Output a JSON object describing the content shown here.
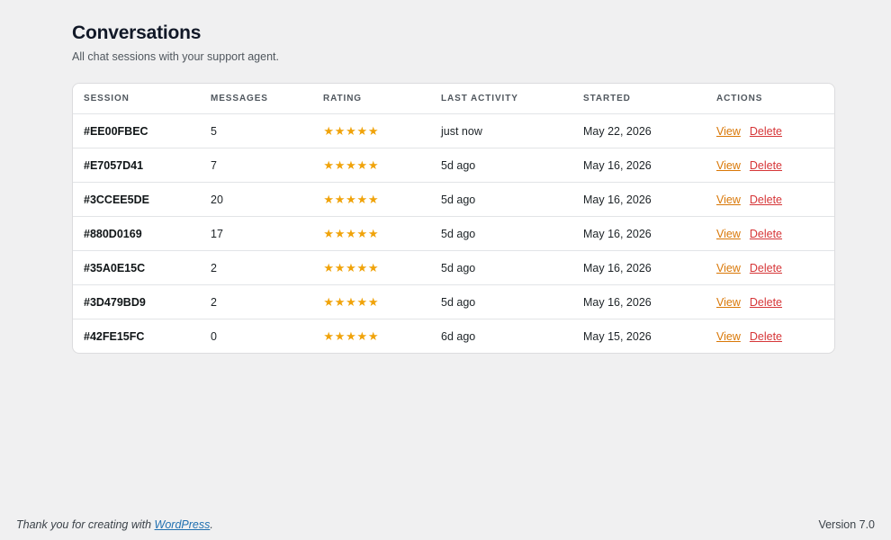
{
  "header": {
    "title": "Conversations",
    "subtitle": "All chat sessions with your support agent."
  },
  "table": {
    "columns": [
      "Session",
      "Messages",
      "Rating",
      "Last Activity",
      "Started",
      "Actions"
    ],
    "view_label": "View",
    "delete_label": "Delete",
    "rows": [
      {
        "session": "#EE00FBEC",
        "messages": "5",
        "rating": 5,
        "last_activity": "just now",
        "started": "May 22, 2026"
      },
      {
        "session": "#E7057D41",
        "messages": "7",
        "rating": 5,
        "last_activity": "5d ago",
        "started": "May 16, 2026"
      },
      {
        "session": "#3CCEE5DE",
        "messages": "20",
        "rating": 5,
        "last_activity": "5d ago",
        "started": "May 16, 2026"
      },
      {
        "session": "#880D0169",
        "messages": "17",
        "rating": 5,
        "last_activity": "5d ago",
        "started": "May 16, 2026"
      },
      {
        "session": "#35A0E15C",
        "messages": "2",
        "rating": 5,
        "last_activity": "5d ago",
        "started": "May 16, 2026"
      },
      {
        "session": "#3D479BD9",
        "messages": "2",
        "rating": 5,
        "last_activity": "5d ago",
        "started": "May 16, 2026"
      },
      {
        "session": "#42FE15FC",
        "messages": "0",
        "rating": 5,
        "last_activity": "6d ago",
        "started": "May 15, 2026"
      }
    ]
  },
  "footer": {
    "thanks_prefix": "Thank you for creating with ",
    "wordpress_link": "WordPress",
    "thanks_suffix": ".",
    "version": "Version 7.0"
  },
  "colors": {
    "star": "#f0a30a",
    "view_link": "#d97706",
    "delete_link": "#d63638",
    "background": "#f0f0f1"
  },
  "icons": {
    "rating": "star-icon"
  }
}
